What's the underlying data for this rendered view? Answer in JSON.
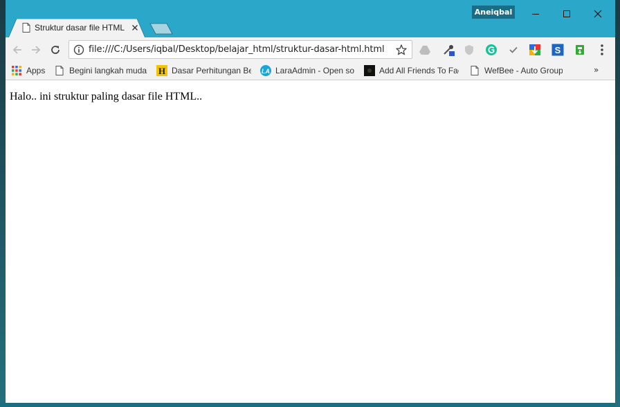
{
  "window": {
    "profile_name": "Aneiqbal",
    "controls": {
      "minimize": "minimize",
      "maximize": "maximize",
      "close": "close"
    }
  },
  "tabs": [
    {
      "title": "Struktur dasar file HTML",
      "icon": "page-icon",
      "active": true
    }
  ],
  "toolbar": {
    "url": "file:///C:/Users/iqbal/Desktop/belajar_html/struktur-dasar-html.html",
    "extensions": [
      "google-drive-icon",
      "eyedropper-icon",
      "shield-icon",
      "grammarly-icon",
      "check-icon",
      "image-downloader-icon",
      "s-extension-icon",
      "green-extension-icon"
    ]
  },
  "bookmarks": [
    {
      "label": "Apps",
      "icon": "apps-grid-icon"
    },
    {
      "label": "Begini langkah mudah",
      "icon": "page-icon"
    },
    {
      "label": "Dasar Perhitungan Be",
      "icon": "h-logo-icon"
    },
    {
      "label": "LaraAdmin - Open so",
      "icon": "laraadmin-icon"
    },
    {
      "label": "Add All Friends To Fac",
      "icon": "dark-icon"
    },
    {
      "label": "WefBee - Auto Group",
      "icon": "page-icon"
    }
  ],
  "bookmarks_more": "»",
  "page": {
    "text": "Halo.. ini struktur paling dasar file HTML.."
  },
  "colors": {
    "titlebar": "#2ba8c9",
    "profile_badge": "#1a6d86",
    "toolbar": "#f2f2f2"
  }
}
